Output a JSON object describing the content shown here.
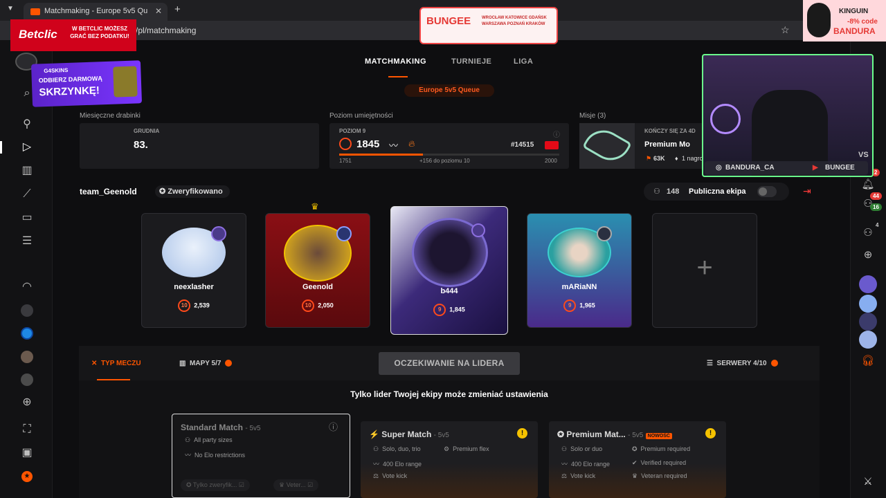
{
  "browser": {
    "tab_title": "Matchmaking - Europe 5v5 Qu",
    "url": "/pl/matchmaking"
  },
  "nav": {
    "tabs": [
      "MATCHMAKING",
      "TURNIEJE",
      "LIGA"
    ],
    "queue": "Europe 5v5 Queue"
  },
  "stats": {
    "ladder_label": "Miesięczne drabinki",
    "ladder_month": "GRUDNIA",
    "ladder_rank": "83.",
    "skill_label": "Poziom umiejętności",
    "skill_level": "POZIOM 9",
    "elo": "1845",
    "rank": "#14515",
    "range_min": "1751",
    "to_next": "+156 do poziomu 10",
    "range_max": "2000",
    "elo_progress": 0.38,
    "missions_label": "Misje (3)",
    "missions_ends": "KOŃCZY SIĘ ZA 4D",
    "mission_title": "Premium Mo",
    "mission_reward_points": "63K",
    "mission_reward_text": "1 nagroda"
  },
  "party": {
    "team_name": "team_Geenold",
    "verified": "Zweryfikowano",
    "count": "148",
    "public_label": "Publiczna ekipa"
  },
  "players": [
    {
      "name": "neexlasher",
      "level": "10",
      "elo": "2,539"
    },
    {
      "name": "Geenold",
      "level": "10",
      "elo": "2,050"
    },
    {
      "name": "b444",
      "level": "9",
      "elo": "1,845"
    },
    {
      "name": "mARiaNN",
      "level": "9",
      "elo": "1,965"
    }
  ],
  "settings": {
    "tab_match_type": "TYP MECZU",
    "tab_maps": "MAPY 5/7",
    "waiting_button": "OCZEKIWANIE NA LIDERA",
    "tab_servers": "SERWERY 4/10",
    "leader_note": "Tylko lider Twojej ekipy może zmieniać ustawienia"
  },
  "match_types": [
    {
      "title": "Standard Match",
      "mode": "5v5",
      "features": [
        "All party sizes",
        "No Elo restrictions"
      ],
      "chips": [
        "Tylko zweryfik...",
        "Veter..."
      ]
    },
    {
      "title": "Super Match",
      "mode": "5v5",
      "features": [
        "Solo, duo, trio",
        "Premium flex",
        "400 Elo range",
        "Vote kick"
      ]
    },
    {
      "title": "Premium Mat...",
      "mode": "5v5",
      "badge": "NOWOŚĆ",
      "features": [
        "Solo or duo",
        "Premium required",
        "400 Elo range",
        "Verified required",
        "Vote kick",
        "Veteran required"
      ]
    }
  ],
  "right_sidebar": {
    "badge_red": "2",
    "badge_notifications": "44",
    "badge_friends": "16",
    "badge_party": "4"
  },
  "overlays": {
    "betclic_brand": "Betclic",
    "betclic_text": "W BETCLIC MOŻESZ GRAĆ BEZ PODATKU!",
    "bungee_brand": "BUNGEE",
    "bungee_cities": "WROCŁAW KATOWICE GDAŃSK WARSZAWA POZNAŃ KRAKÓW",
    "kinguin_brand": "KINGUIN",
    "kinguin_discount": "-8% code",
    "kinguin_code": "BANDURA",
    "g4skins_brand": "G4SKINS",
    "skrzynke_line1": "ODBIERZ DARMOWĄ",
    "skrzynke_line2": "SKRZYNKĘ!",
    "instagram": "BANDURA_CA",
    "youtube": "BUNGEE",
    "webcam_label": "VS"
  },
  "colors": {
    "accent": "#ff5500",
    "bg": "#0e0e10",
    "card": "#1c1c1f"
  }
}
